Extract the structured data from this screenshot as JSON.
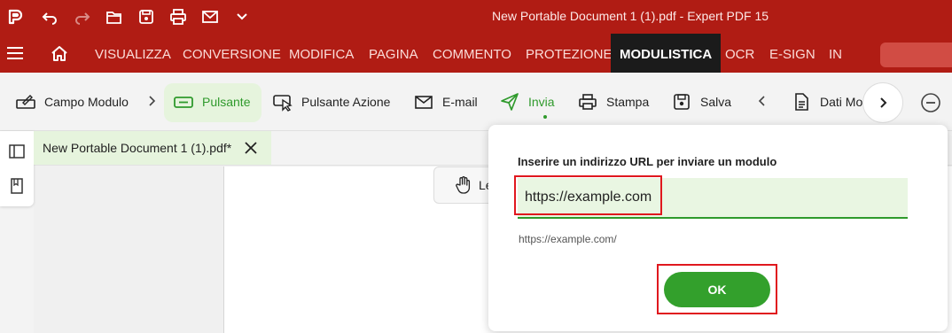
{
  "window": {
    "title": "New Portable Document 1 (1).pdf  -  Expert PDF 15"
  },
  "quick_access": [
    {
      "icon": "app-logo-icon"
    },
    {
      "icon": "undo-icon"
    },
    {
      "icon": "redo-icon"
    },
    {
      "icon": "open-folder-icon"
    },
    {
      "icon": "save-icon"
    },
    {
      "icon": "print-icon"
    },
    {
      "icon": "mail-icon"
    },
    {
      "icon": "chevron-down-icon"
    }
  ],
  "menu": {
    "items": [
      "VISUALIZZA",
      "CONVERSIONE",
      "MODIFICA",
      "PAGINA",
      "COMMENTO",
      "PROTEZIONE",
      "MODULISTICA",
      "OCR",
      "E-SIGN",
      "IN"
    ],
    "active": "MODULISTICA"
  },
  "ribbon": {
    "campo_modulo": "Campo Modulo",
    "pulsante": "Pulsante",
    "pulsante_azione": "Pulsante Azione",
    "email": "E-mail",
    "invia": "Invia",
    "stampa": "Stampa",
    "salva": "Salva",
    "dati_modulo": "Dati Mo"
  },
  "document": {
    "tab_title": "New Portable Document 1 (1).pdf*",
    "hand_tool_label": "Le"
  },
  "dialog": {
    "label": "Inserire un indirizzo URL per inviare un modulo",
    "url_value": "https://example.com",
    "hint": "https://example.com/",
    "ok_label": "OK"
  },
  "colors": {
    "brand_red": "#b01c14",
    "accent_green": "#2f9a2c",
    "highlight_red": "#e0181e"
  }
}
